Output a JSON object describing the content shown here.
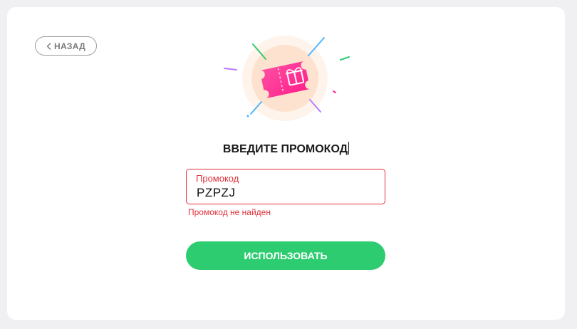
{
  "back": {
    "label": "НАЗАД",
    "icon": "chevron-left-icon"
  },
  "hero": {
    "icon": "gift-ticket-icon"
  },
  "title": "ВВЕДИТЕ ПРОМОКОД",
  "promo_field": {
    "label": "Промокод",
    "value": "PZPZJ"
  },
  "error": "Промокод не найден",
  "submit": {
    "label": "ИСПОЛЬЗОВАТЬ"
  },
  "colors": {
    "accent": "#2ecc71",
    "error": "#e0303a",
    "ticket": "#ff2d8f",
    "halo": "#fde8d8"
  }
}
